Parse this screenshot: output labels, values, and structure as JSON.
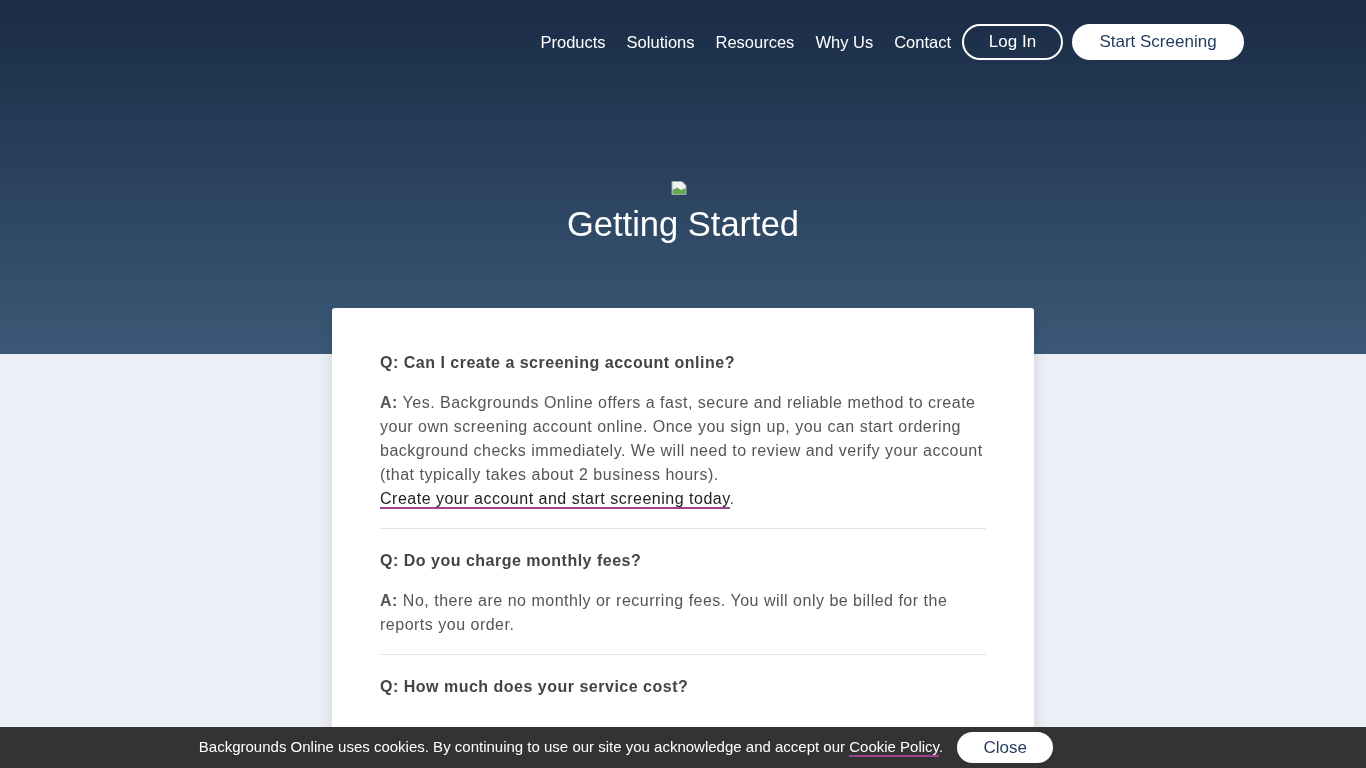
{
  "nav": {
    "links": [
      "Products",
      "Solutions",
      "Resources",
      "Why Us",
      "Contact"
    ],
    "login_button": "Log In",
    "cta_button": "Start Screening"
  },
  "hero": {
    "title": "Getting Started"
  },
  "faq": [
    {
      "question": "Q: Can I create a screening account online?",
      "answer": "**A:** Yes. Backgrounds Online offers a fast, secure and reliable method to create your own screening account online. Once you sign up, you can start ordering background checks immediately. We will need to review and verify your account (that typically takes about 2 business hours). ",
      "link": "Create your account and start screening today",
      "answer_end": "."
    },
    {
      "question": "Q: Do you charge monthly fees?",
      "answer": "**A:** No, there are no monthly or recurring fees. You will only be billed for the reports you order."
    },
    {
      "question": "Q: How much does your service cost?"
    }
  ],
  "cookie_banner": {
    "text": "Backgrounds Online uses cookies. By continuing to use our site you acknowledge and accept our ",
    "link": "Cookie Policy",
    "text_end": ".",
    "button": "Close"
  }
}
